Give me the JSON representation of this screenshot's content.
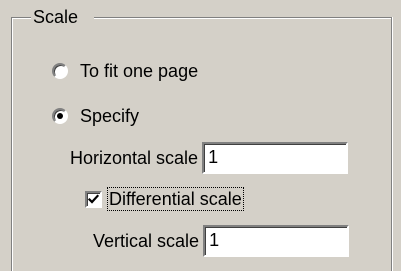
{
  "group": {
    "title": "Scale"
  },
  "options": {
    "fit_label": "To fit one page",
    "fit_selected": false,
    "specify_label": "Specify",
    "specify_selected": true
  },
  "horizontal": {
    "label": "Horizontal scale",
    "value": "1"
  },
  "differential": {
    "label": "Differential scale",
    "checked": true
  },
  "vertical": {
    "label": "Vertical scale",
    "value": "1"
  },
  "icons": {
    "radio": "radio-button-icon",
    "check": "checkmark-icon"
  },
  "colors": {
    "face": "#d4d0c8",
    "shadow": "#808080",
    "highlight": "#ffffff",
    "field": "#ffffff"
  }
}
